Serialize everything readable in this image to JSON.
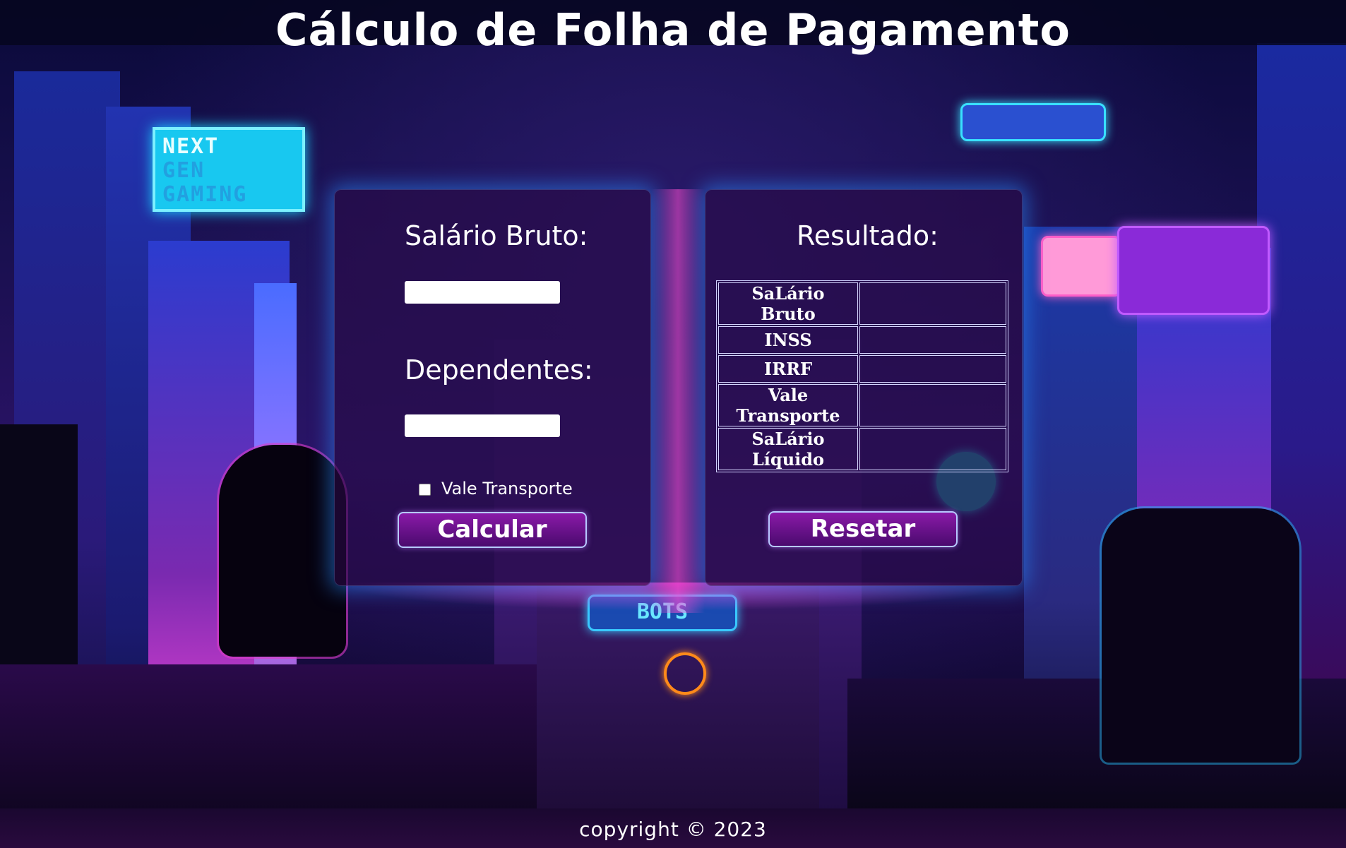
{
  "header": {
    "title": "Cálculo de Folha de Pagamento"
  },
  "form": {
    "salario_label": "Salário Bruto:",
    "salario_value": "",
    "dependentes_label": "Dependentes:",
    "dependentes_value": "",
    "vale_label": "Vale Transporte",
    "vale_checked": false,
    "calcular_label": "Calcular"
  },
  "result": {
    "title": "Resultado:",
    "rows": [
      {
        "label": "SaLário Bruto",
        "value": ""
      },
      {
        "label": "INSS",
        "value": ""
      },
      {
        "label": "IRRF",
        "value": ""
      },
      {
        "label": "Vale Transporte",
        "value": ""
      },
      {
        "label": "SaLário Líquido",
        "value": ""
      }
    ],
    "reset_label": "Resetar"
  },
  "background_signs": {
    "next_sign": [
      "NEXT",
      "GEN",
      "GAMING"
    ],
    "bots_sign": "BOTS"
  },
  "footer": {
    "copyright": "copyright © 2023"
  },
  "colors": {
    "panel_glow": "#2a8cff",
    "neon_pink": "#ff46dc",
    "button_purple": "#7a1a9a"
  }
}
